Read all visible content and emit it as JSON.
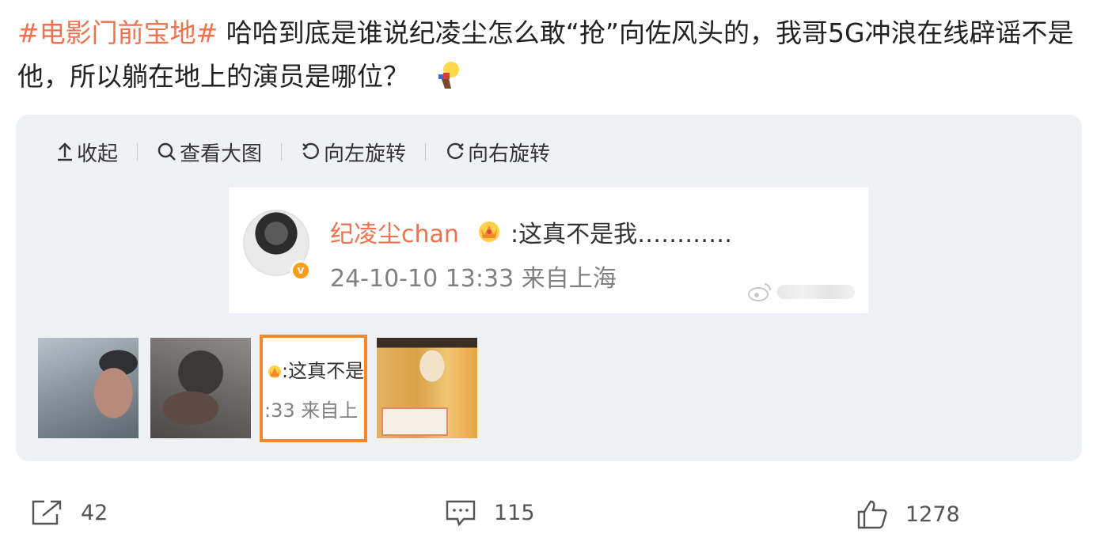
{
  "post": {
    "topic": "#电影门前宝地#",
    "text": " 哈哈到底是谁说纪凌尘怎么敢“抢”向佐风头的，我哥5G冲浪在线辟谣不是他，所以躺在地上的演员是哪位？"
  },
  "toolbar": {
    "collapse": "收起",
    "view_large": "查看大图",
    "rotate_left": "向左旋转",
    "rotate_right": "向右旋转"
  },
  "screenshot": {
    "username": "纪凌尘chan",
    "message": ":这真不是我…………",
    "meta": "24-10-10 13:33 来自上海"
  },
  "thumb3": {
    "line1": ":这真不是",
    "line2": ":33 来自上"
  },
  "actions": {
    "share_count": "42",
    "comment_count": "115",
    "like_count": "1278"
  },
  "colors": {
    "topic": "#eb7350",
    "selected_border": "#f08a2c",
    "media_bg": "#f0f1f5"
  },
  "icons": [
    "collapse-up-icon",
    "magnifier-icon",
    "rotate-left-icon",
    "rotate-right-icon",
    "share-icon",
    "comment-icon",
    "like-icon",
    "crown-icon",
    "verified-icon",
    "bulb-emoji"
  ]
}
